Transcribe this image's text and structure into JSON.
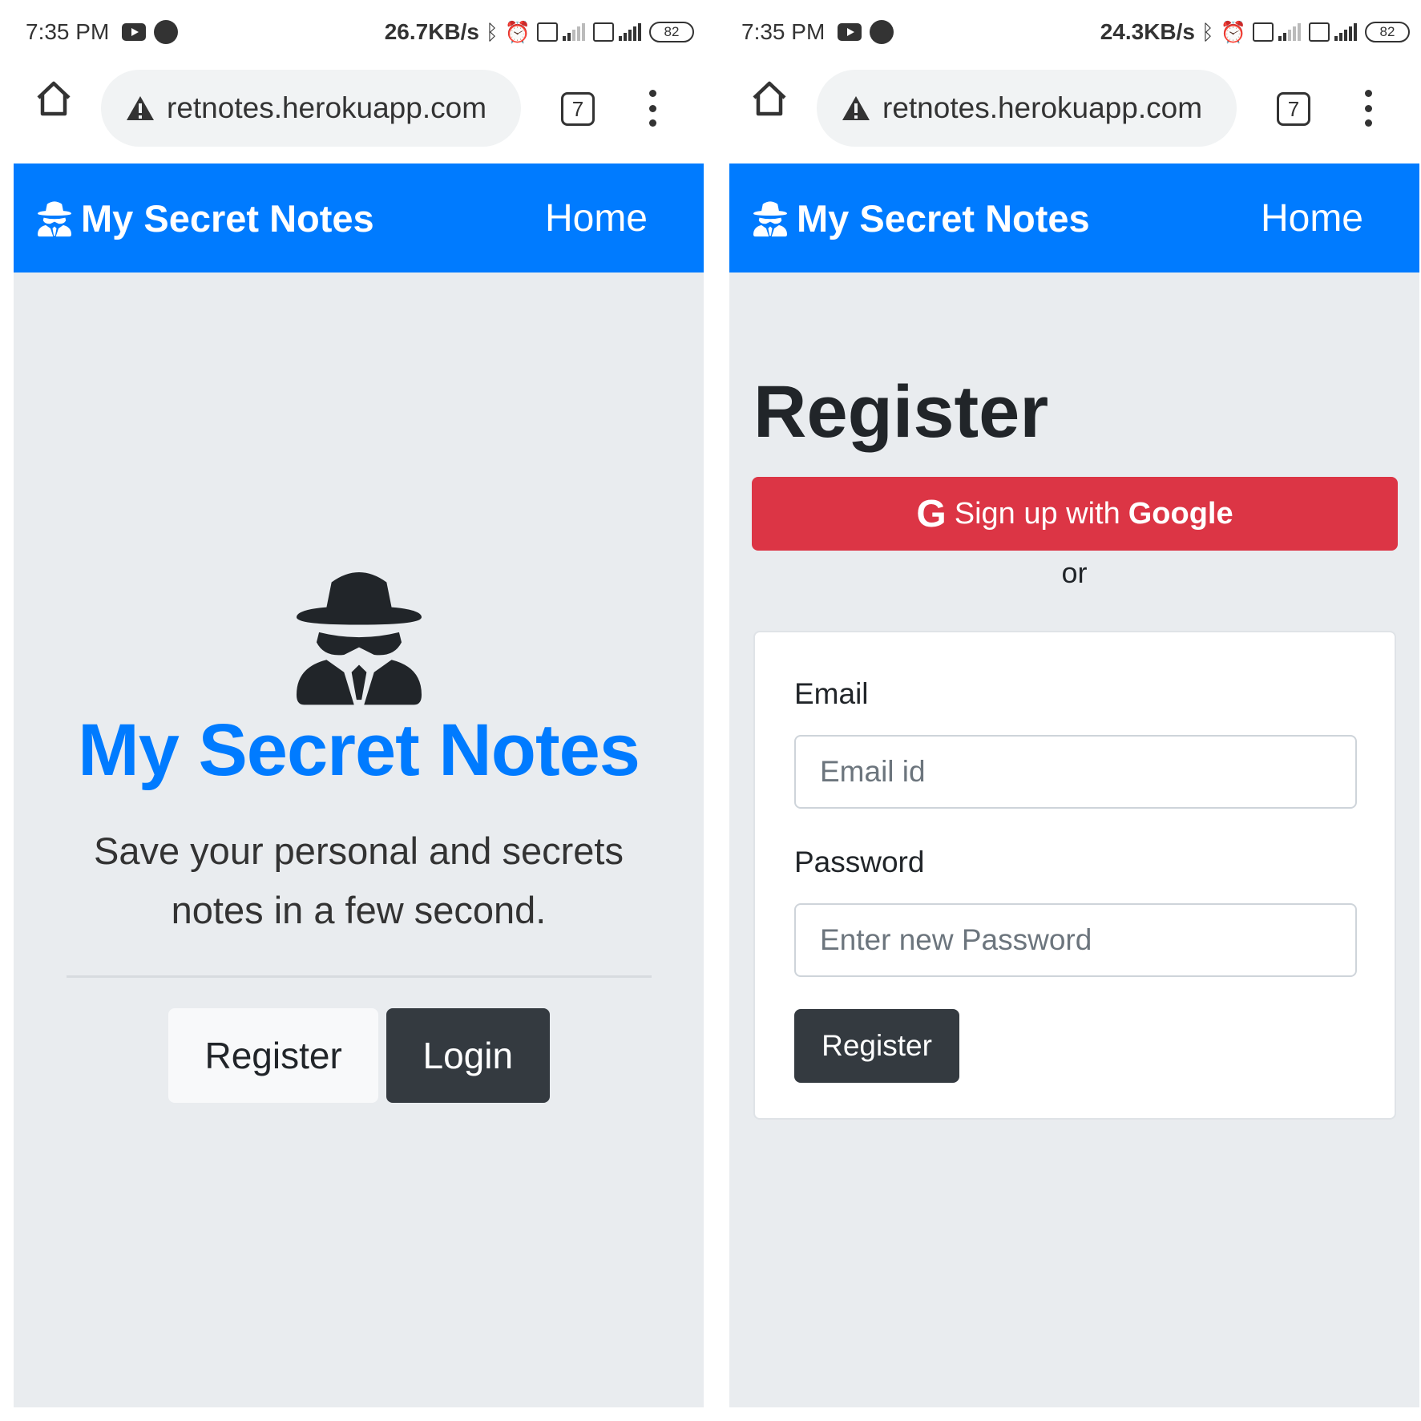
{
  "screens": [
    {
      "status": {
        "time": "7:35 PM",
        "speed": "26.7KB/s",
        "battery": "82"
      },
      "browser": {
        "url": "retnotes.herokuapp.com",
        "tab_count": "7"
      },
      "navbar": {
        "brand": "My Secret Notes",
        "home": "Home"
      },
      "hero": {
        "title": "My Secret Notes",
        "lead": "Save your personal and secrets notes in a few second.",
        "register_label": "Register",
        "login_label": "Login"
      }
    },
    {
      "status": {
        "time": "7:35 PM",
        "speed": "24.3KB/s",
        "battery": "82"
      },
      "browser": {
        "url": "retnotes.herokuapp.com",
        "tab_count": "7"
      },
      "navbar": {
        "brand": "My Secret Notes",
        "home": "Home"
      },
      "register": {
        "title": "Register",
        "google_prefix": "Sign up with",
        "google_brand": "Google",
        "google_icon": "G",
        "or": "or",
        "email_label": "Email",
        "email_placeholder": "Email id",
        "password_label": "Password",
        "password_placeholder": "Enter new Password",
        "submit_label": "Register"
      }
    }
  ],
  "colors": {
    "primary": "#007bff",
    "danger": "#dc3545",
    "dark": "#343a40",
    "light": "#f8f9fa",
    "page_bg": "#e9ecef"
  },
  "icons": [
    "home-icon",
    "warning-icon",
    "tabs-icon",
    "menu-icon",
    "user-secret-icon",
    "google-icon",
    "youtube-icon",
    "phone-icon",
    "bluetooth-icon",
    "alarm-icon",
    "signal-icon",
    "battery-icon"
  ]
}
